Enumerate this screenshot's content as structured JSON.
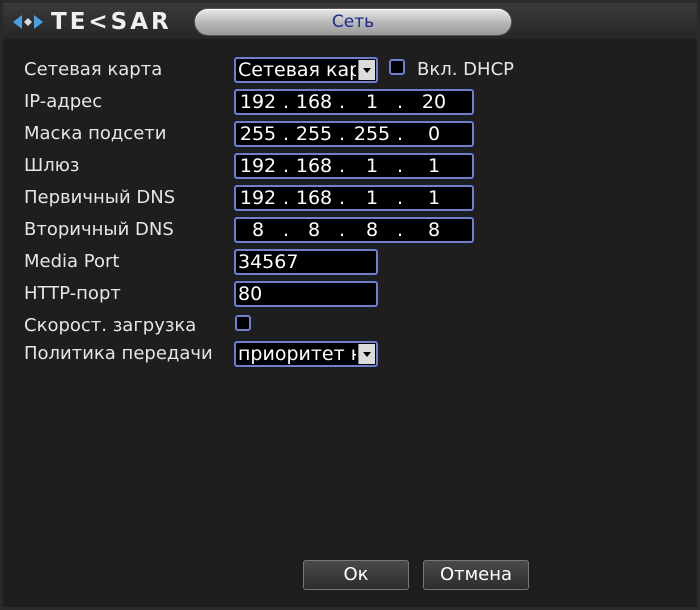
{
  "window": {
    "title": "Сеть"
  },
  "logo": {
    "text": "TE<SAR"
  },
  "form": {
    "network_card": {
      "label": "Сетевая карта",
      "value": "Сетевая карта"
    },
    "dhcp": {
      "label": "Вкл. DHCP",
      "checked": false
    },
    "ip_address": {
      "label": "IP-адрес",
      "octets": [
        "192",
        "168",
        "1",
        "20"
      ]
    },
    "subnet_mask": {
      "label": "Маска подсети",
      "octets": [
        "255",
        "255",
        "255",
        "0"
      ]
    },
    "gateway": {
      "label": "Шлюз",
      "octets": [
        "192",
        "168",
        "1",
        "1"
      ]
    },
    "primary_dns": {
      "label": "Первичный DNS",
      "octets": [
        "192",
        "168",
        "1",
        "1"
      ]
    },
    "secondary_dns": {
      "label": "Вторичный DNS",
      "octets": [
        "8",
        "8",
        "8",
        "8"
      ]
    },
    "media_port": {
      "label": "Media Port",
      "value": "34567"
    },
    "http_port": {
      "label": "HTTP-порт",
      "value": "80"
    },
    "fast_download": {
      "label": "Скорост. загрузка",
      "checked": false
    },
    "transfer_policy": {
      "label": "Политика передачи",
      "value": "приоритет н"
    }
  },
  "buttons": {
    "ok": "Ок",
    "cancel": "Отмена"
  },
  "colors": {
    "field_border": "#6f7fd0",
    "title_text": "#1a2a8a",
    "logo_accent": "#4aa0e0"
  },
  "separator": "."
}
